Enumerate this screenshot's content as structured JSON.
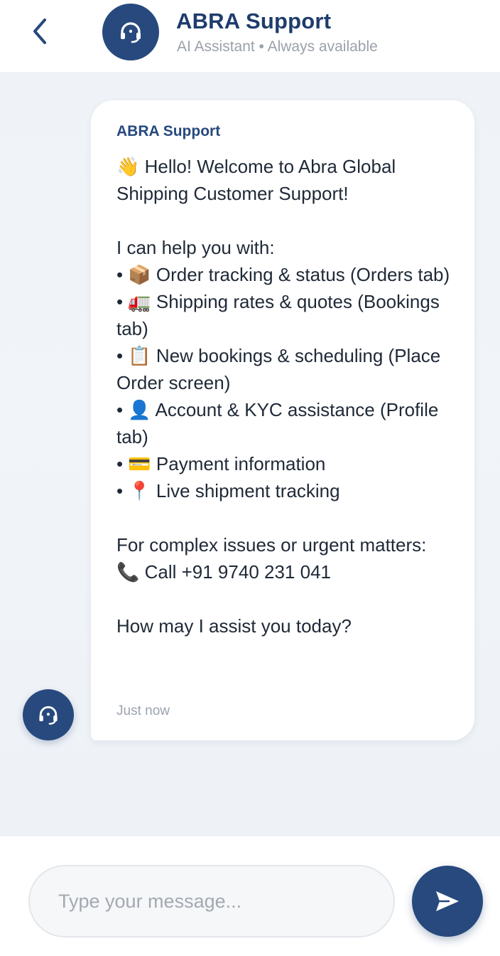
{
  "header": {
    "title": "ABRA Support",
    "subtitle": "AI Assistant • Always available",
    "back_icon": "chevron-left-icon",
    "avatar_icon": "headset-icon"
  },
  "message": {
    "sender": "ABRA Support",
    "text": "👋 Hello! Welcome to Abra Global Shipping Customer Support!\n\nI can help you with:\n• 📦 Order tracking & status (Orders tab)\n• 🚛 Shipping rates & quotes (Bookings tab)\n• 📋 New bookings & scheduling (Place Order screen)\n• 👤 Account & KYC assistance (Profile tab)\n• 💳 Payment information\n• 📍 Live shipment tracking\n\nFor complex issues or urgent matters:\n📞 Call +91 9740 231 041\n\nHow may I assist you today?",
    "time": "Just now",
    "avatar_icon": "headset-icon"
  },
  "composer": {
    "placeholder": "Type your message...",
    "value": "",
    "send_icon": "send-icon"
  },
  "colors": {
    "brand": "#27497d",
    "title": "#1e3c6c",
    "background": "#eef2f7",
    "muted": "#9aa1a9"
  }
}
